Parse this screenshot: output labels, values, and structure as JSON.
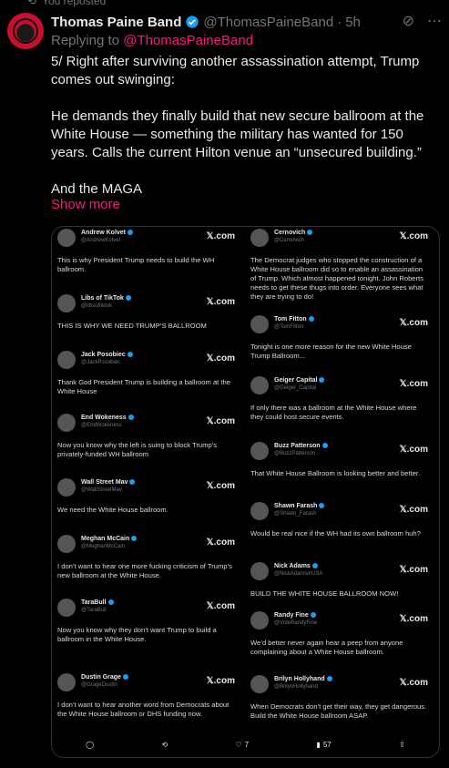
{
  "repost": {
    "label": "You reposted"
  },
  "author": {
    "name": "Thomas Paine Band",
    "handle": "@ThomasPaineBand",
    "time": "5h"
  },
  "reply": {
    "prefix": "Replying to",
    "target": "@ThomasPaineBand"
  },
  "tweet": {
    "text": "5/ Right after surviving another assassination attempt, Trump comes out swinging:\n\nHe demands they finally build that new secure ballroom at the White House — something the military has wanted for 150 years. Calls the current Hilton venue an “unsecured building.”\n\nAnd the MAGA",
    "show_more": "Show more"
  },
  "media": {
    "left": [
      {
        "name": "Andrew Kolvet",
        "handle": "@AndrewKolvet",
        "x": "𝕏.com",
        "text": "This is why President Trump needs to build the WH ballroom."
      },
      {
        "name": "Libs of TikTok",
        "handle": "@libsoftiktok",
        "x": "𝕏.com",
        "text": "THIS IS WHY WE NEED TRUMP’S BALLROOM"
      },
      {
        "name": "Jack Posobiec",
        "handle": "@JackPosobiec",
        "x": "𝕏.com",
        "text": "Thank God President Trump is building a ballroom at the White House"
      },
      {
        "name": "End Wokeness",
        "handle": "@EndWokeness",
        "x": "𝕏.com",
        "text": "Now you know why the left is suing to block Trump’s privately-funded WH ballroom"
      },
      {
        "name": "Wall Street Mav",
        "handle": "@WallStreetMav",
        "x": "𝕏.com",
        "text": "We need the White House ballroom."
      },
      {
        "name": "Meghan McCain",
        "handle": "@MeghanMcCain",
        "x": "𝕏.com",
        "text": "I don’t want to hear one more fucking criticism of Trump’s new ballroom at the White House."
      },
      {
        "name": "TaraBull",
        "handle": "@TaraBull",
        "x": "𝕏.com",
        "text": "Now you know why they don’t want Trump to build a ballroom in the White House."
      },
      {
        "name": "Dustin Grage",
        "handle": "@GrageDustin",
        "x": "𝕏.com",
        "text": "I don’t want to hear another word from Democrats about the White House ballroom or DHS funding now."
      }
    ],
    "right": [
      {
        "name": "Cernovich",
        "handle": "@Cernovich",
        "x": "𝕏.com",
        "text": "The Democrat judges who stopped the construction of a White House ballroom did so to enable an assassination of Trump. Which almost happened tonight. John Roberts needs to get these thugs into order. Everyone sees what they are trying to do!"
      },
      {
        "name": "Tom Fitton",
        "handle": "@TomFitton",
        "x": "𝕏.com",
        "text": "Tonight is one more reason for the new White House Trump Ballroom..."
      },
      {
        "name": "Geiger Capital",
        "handle": "@Geiger_Capital",
        "x": "𝕏.com",
        "text": "If only there was a ballroom at the White House where they could host secure events."
      },
      {
        "name": "Buzz Patterson",
        "handle": "@BuzzPatterson",
        "x": "𝕏.com",
        "text": "That White House Ballroom is looking better and better."
      },
      {
        "name": "Shawn Farash",
        "handle": "@Shawn_Farash",
        "x": "𝕏.com",
        "text": "Would be real nice if the WH had its own ballroom huh?"
      },
      {
        "name": "Nick Adams",
        "handle": "@NickAdamsinUSA",
        "x": "𝕏.com",
        "text": "BUILD THE WHITE HOUSE BALLROOM NOW!"
      },
      {
        "name": "Randy Fine",
        "handle": "@VoteRandyFine",
        "x": "𝕏.com",
        "text": "We’d better never again hear a peep from anyone complaining about a White House ballroom."
      },
      {
        "name": "Brilyn Hollyhand",
        "handle": "@BrilynHollyhand",
        "x": "𝕏.com",
        "text": "When Democrats don’t get their way, they get dangerous. Build the White House ballroom ASAP."
      }
    ],
    "actions": {
      "likes": "7",
      "views": "57"
    }
  }
}
